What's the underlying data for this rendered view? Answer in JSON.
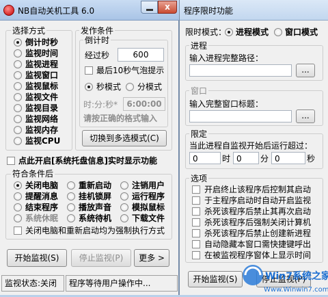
{
  "back_window": {
    "title": "程序限时功能",
    "limit_mode_label": "限时模式：",
    "limit_modes": [
      "进程模式",
      "窗口模式"
    ],
    "process_group": {
      "title": "进程",
      "prompt": "输入进程完整路径：",
      "path_value": "",
      "browse_label": "..."
    },
    "window_group": {
      "title": "窗口",
      "prompt": "输入完整窗口标题：",
      "title_value": "",
      "browse_label": "..."
    },
    "limit_group": {
      "title": "限定",
      "description": "当此进程自监视开始后运行超过：",
      "hours": "0",
      "hours_unit": "时",
      "minutes": "0",
      "minutes_unit": "分",
      "seconds": "0",
      "seconds_unit": "秒"
    },
    "options_group": {
      "title": "选项",
      "items": [
        "开启终止该程序后控制其启动",
        "于主程序启动时自动开启监视",
        "杀死该程序后禁止其再次启动",
        "杀死该程序后强制关闭计算机",
        "杀死该程序后禁止创建新进程",
        "自动隐藏本窗口需快捷键呼出",
        "在被监视程序窗体上显示时间"
      ]
    },
    "start_button": "开始监视(S)",
    "stop_button": "停止监视(P)"
  },
  "main_window": {
    "title": "NB自动关机工具 6.0",
    "close_glyph": "x",
    "method_group": {
      "title": "选择方式",
      "items": [
        "倒计时秒",
        "监视时间",
        "监视进程",
        "监视窗口",
        "监视鼠标",
        "监视文件",
        "监视目录",
        "监视网络",
        "监视内存",
        "监视CPU"
      ],
      "selected": 0
    },
    "trigger_group": {
      "title": "发作条件",
      "countdown_title": "倒计时",
      "elapsed_label": "经过秒",
      "elapsed_value": "600",
      "bubble_label": "最后10秒气泡提示",
      "second_mode": "秒模式",
      "minute_mode": "分模式",
      "time_label": "时:分:秒*",
      "time_value": "6:00:00",
      "hint": "请按正确的格式输入",
      "switch_button": "切换到多选模式(C)"
    },
    "tray_check": "点此开启[系统托盘信息]实时显示功能",
    "actions_group": {
      "title": "符合条件后",
      "items": [
        "关闭电脑",
        "重新启动",
        "注销用户",
        "提醒消息",
        "挂机锁屏",
        "运行程序",
        "结束程序",
        "播放声音",
        "模拟鼠标",
        "系统休眠",
        "系统待机",
        "下载文件"
      ],
      "selected": 0,
      "force_check": "关闭电脑和重新启动均为强制执行方式"
    },
    "start_button": "开始监视(S)",
    "stop_button": "停止监视(P)",
    "more_button": "更多 >",
    "status_left": "监视状态:关闭",
    "status_right": "程序等待用户操作中..."
  },
  "watermark": {
    "text": "Win7系统之家",
    "url": "Www.Winwin7.com"
  }
}
